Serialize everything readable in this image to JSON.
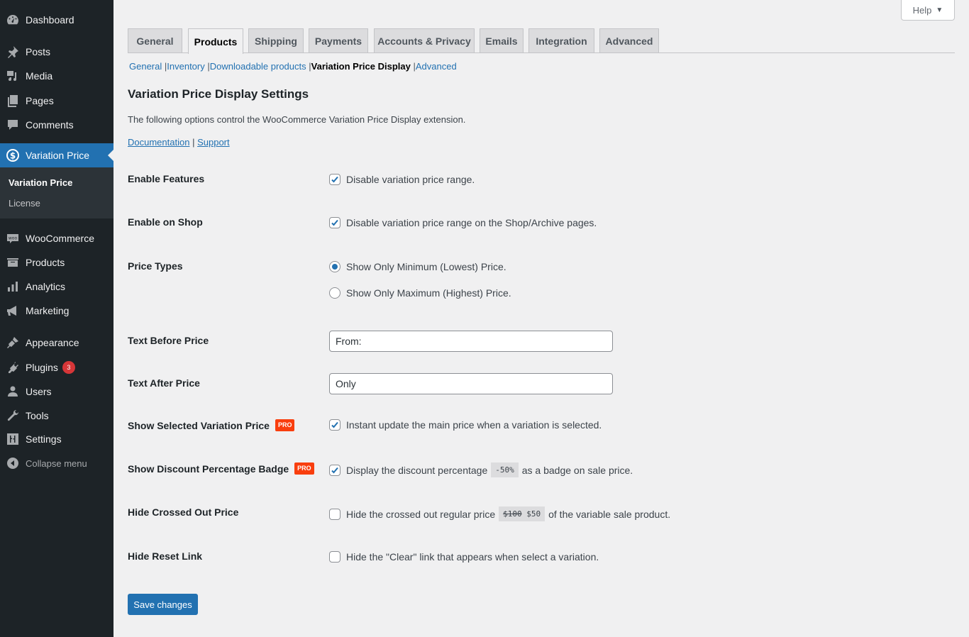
{
  "sidebar": {
    "items": [
      {
        "label": "Dashboard",
        "icon": "dashboard-icon"
      },
      {
        "label": "Posts",
        "icon": "pin-icon"
      },
      {
        "label": "Media",
        "icon": "media-icon"
      },
      {
        "label": "Pages",
        "icon": "pages-icon"
      },
      {
        "label": "Comments",
        "icon": "comment-icon"
      },
      {
        "label": "Variation Price",
        "icon": "dollar-circle-icon",
        "active": true
      },
      {
        "label": "WooCommerce",
        "icon": "woo-icon"
      },
      {
        "label": "Products",
        "icon": "archive-box-icon"
      },
      {
        "label": "Analytics",
        "icon": "bar-chart-icon"
      },
      {
        "label": "Marketing",
        "icon": "megaphone-icon"
      },
      {
        "label": "Appearance",
        "icon": "paintbrush-icon"
      },
      {
        "label": "Plugins",
        "icon": "plug-icon",
        "badge": "3"
      },
      {
        "label": "Users",
        "icon": "user-icon"
      },
      {
        "label": "Tools",
        "icon": "wrench-icon"
      },
      {
        "label": "Settings",
        "icon": "sliders-icon"
      }
    ],
    "submenu": [
      {
        "label": "Variation Price",
        "current": true
      },
      {
        "label": "License"
      }
    ],
    "collapse_label": "Collapse menu"
  },
  "help": {
    "label": "Help",
    "arrow": "▼"
  },
  "tabs": [
    {
      "label": "General"
    },
    {
      "label": "Products",
      "active": true
    },
    {
      "label": "Shipping"
    },
    {
      "label": "Payments"
    },
    {
      "label": "Accounts & Privacy"
    },
    {
      "label": "Emails"
    },
    {
      "label": "Integration"
    },
    {
      "label": "Advanced"
    }
  ],
  "subnav": [
    {
      "label": "General"
    },
    {
      "label": "Inventory"
    },
    {
      "label": "Downloadable products"
    },
    {
      "label": "Variation Price Display",
      "current": true
    },
    {
      "label": "Advanced"
    }
  ],
  "page": {
    "title": "Variation Price Display Settings",
    "description": "The following options control the WooCommerce Variation Price Display extension.",
    "doc_link": "Documentation",
    "separator": "|",
    "support_link": "Support"
  },
  "settings": {
    "enable_features": {
      "label": "Enable Features",
      "text": "Disable variation price range.",
      "checked": true
    },
    "enable_on_shop": {
      "label": "Enable on Shop",
      "text": "Disable variation price range on the Shop/Archive pages.",
      "checked": true
    },
    "price_types": {
      "label": "Price Types",
      "options": [
        {
          "text": "Show Only Minimum (Lowest) Price.",
          "selected": true
        },
        {
          "text": "Show Only Maximum (Highest) Price.",
          "selected": false
        }
      ]
    },
    "text_before": {
      "label": "Text Before Price",
      "value": "From:"
    },
    "text_after": {
      "label": "Text After Price",
      "value": "Only"
    },
    "show_selected": {
      "label": "Show Selected Variation Price",
      "pro": "PRO",
      "text": "Instant update the main price when a variation is selected.",
      "checked": true
    },
    "discount_badge": {
      "label": "Show Discount Percentage Badge",
      "pro": "PRO",
      "text_before": "Display the discount percentage",
      "code": "-50%",
      "text_after": "as a badge on sale price.",
      "checked": true
    },
    "hide_crossed": {
      "label": "Hide Crossed Out Price",
      "text_before": "Hide the crossed out regular price",
      "code_old": "$100",
      "code_new": "$50",
      "text_after": "of the variable sale product.",
      "checked": false
    },
    "hide_reset": {
      "label": "Hide Reset Link",
      "text": "Hide the \"Clear\" link that appears when select a variation.",
      "checked": false
    }
  },
  "save_label": "Save changes"
}
